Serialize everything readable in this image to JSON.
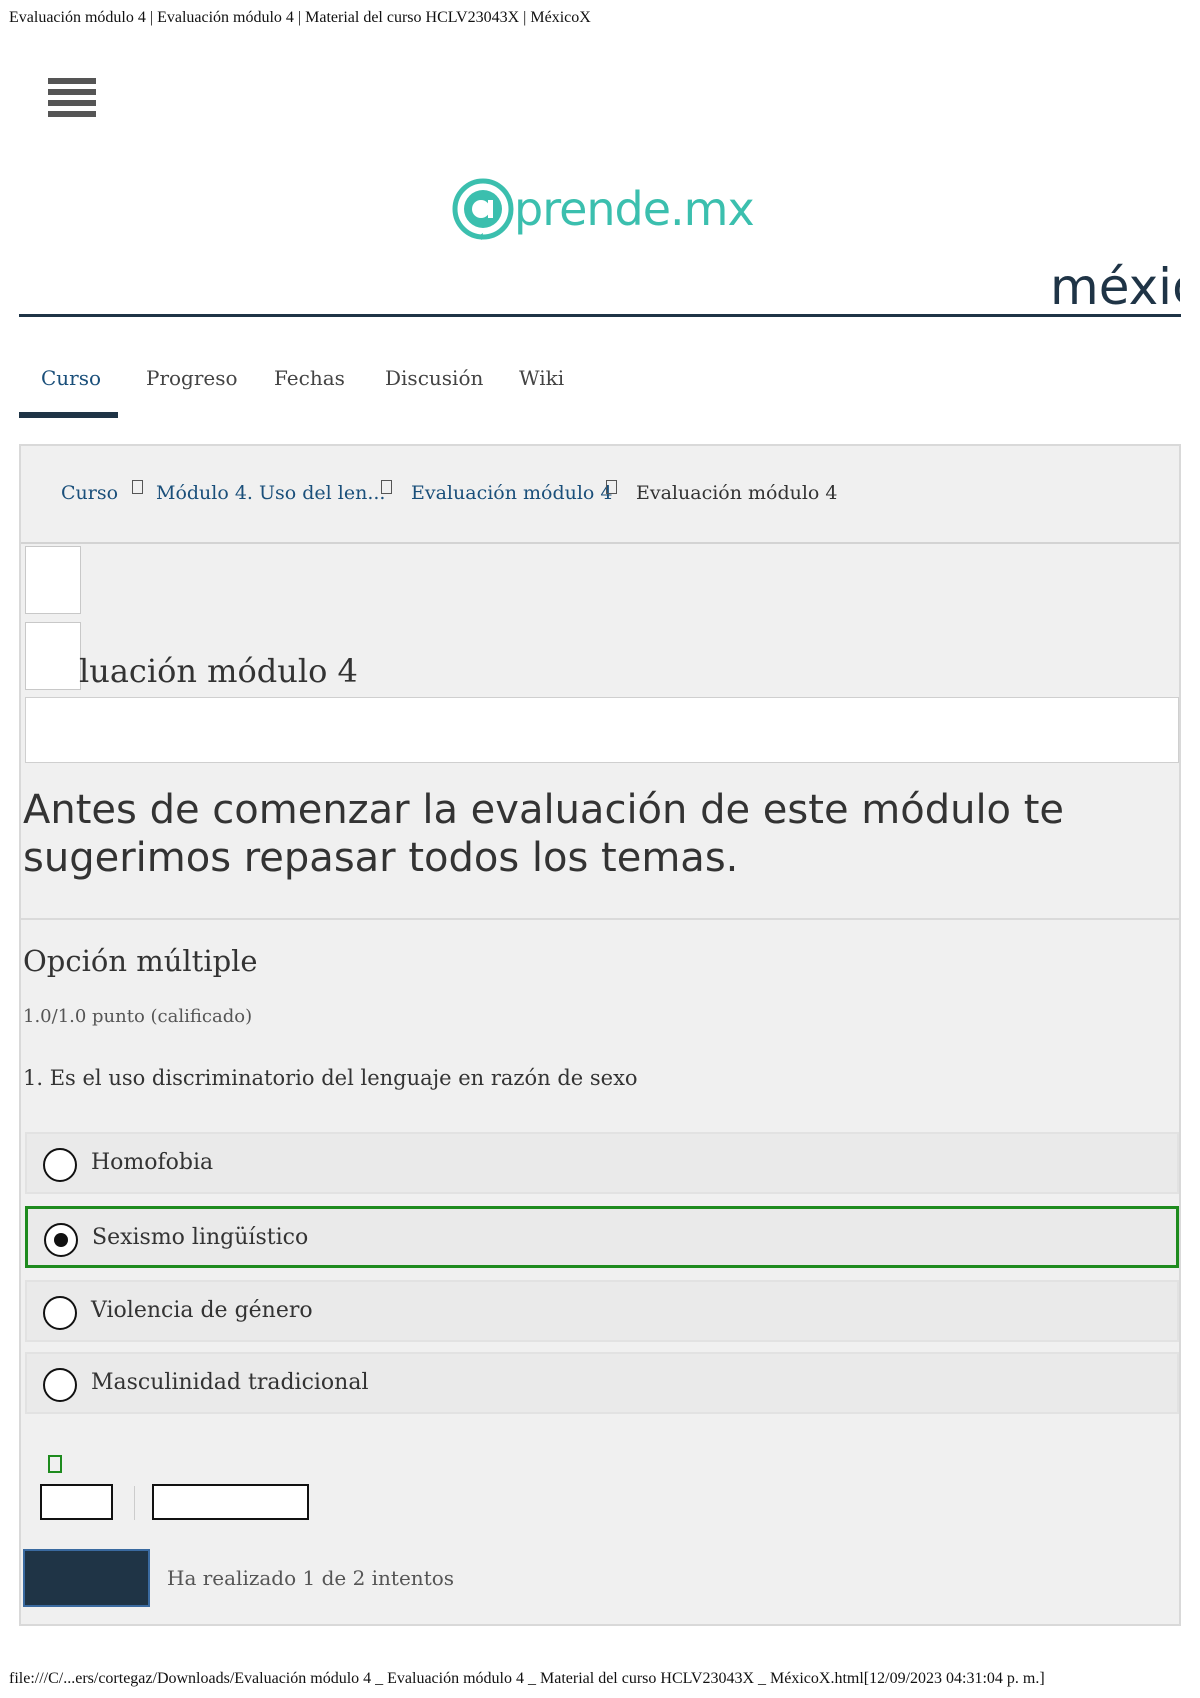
{
  "print": {
    "header": "Evaluación módulo 4 | Evaluación módulo 4 | Material del curso HCLV23043X | MéxicoX",
    "footer": "file:///C/...ers/cortegaz/Downloads/Evaluación módulo 4 _ Evaluación módulo 4 _ Material del curso HCLV23043X _ MéxicoX.html[12/09/2023 04:31:04 p. m.]"
  },
  "brand": {
    "logo_text": "prende.mx",
    "logo_color": "#3bbfae",
    "mexico_text": "méxic",
    "dark_color": "#1f3446"
  },
  "tabs": [
    {
      "label": "Curso",
      "active": true
    },
    {
      "label": "Progreso"
    },
    {
      "label": "Fechas"
    },
    {
      "label": "Discusión"
    },
    {
      "label": "Wiki"
    }
  ],
  "breadcrumb": [
    {
      "label": "Curso"
    },
    {
      "label": "Módulo 4. Uso del len..."
    },
    {
      "label": "Evaluación módulo 4"
    },
    {
      "label": "Evaluación módulo 4"
    }
  ],
  "unit": {
    "title": "luación módulo 4"
  },
  "intro": "Antes de comenzar la evaluación de este módulo te sugerimos repasar todos los temas.",
  "problem": {
    "type": "Opción múltiple",
    "points": "1.0/1.0 punto (calificado)",
    "question": "1. Es el uso discriminatorio del lenguaje en razón de sexo",
    "options": [
      {
        "label": "Homofobia",
        "selected": false
      },
      {
        "label": "Sexismo lingüístico",
        "selected": true
      },
      {
        "label": "Violencia de género",
        "selected": false
      },
      {
        "label": "Masculinidad tradicional",
        "selected": false
      }
    ],
    "correct_color": "#1e8b1e",
    "attempts": "Ha realizado 1 de 2 intentos"
  }
}
